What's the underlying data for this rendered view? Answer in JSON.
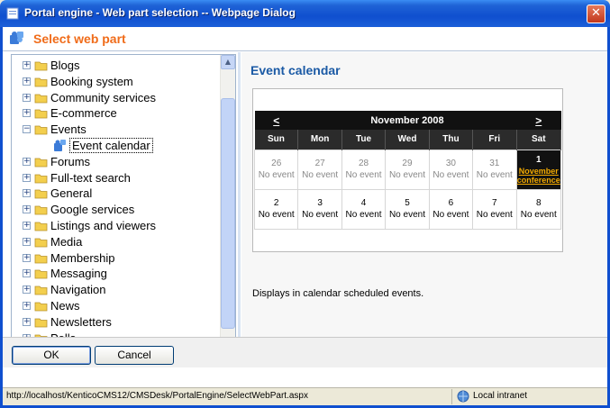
{
  "window": {
    "title": "Portal engine - Web part selection -- Webpage Dialog",
    "close_glyph": "✕"
  },
  "header": {
    "title": "Select web part"
  },
  "tree": {
    "items": [
      {
        "label": "Blogs",
        "exp": "+"
      },
      {
        "label": "Booking system",
        "exp": "+"
      },
      {
        "label": "Community services",
        "exp": "+"
      },
      {
        "label": "E-commerce",
        "exp": "+"
      },
      {
        "label": "Events",
        "exp": "−"
      },
      {
        "label": "Event calendar",
        "child": true
      },
      {
        "label": "Forums",
        "exp": "+"
      },
      {
        "label": "Full-text search",
        "exp": "+"
      },
      {
        "label": "General",
        "exp": "+"
      },
      {
        "label": "Google services",
        "exp": "+"
      },
      {
        "label": "Listings and viewers",
        "exp": "+"
      },
      {
        "label": "Media",
        "exp": "+"
      },
      {
        "label": "Membership",
        "exp": "+"
      },
      {
        "label": "Messaging",
        "exp": "+"
      },
      {
        "label": "Navigation",
        "exp": "+"
      },
      {
        "label": "News",
        "exp": "+"
      },
      {
        "label": "Newsletters",
        "exp": "+"
      },
      {
        "label": "Polls",
        "exp": "+"
      }
    ],
    "scroll_up": "▲",
    "scroll_down": "▼"
  },
  "preview": {
    "title": "Event calendar",
    "description": "Displays in calendar scheduled events.",
    "calendar": {
      "prev": "<",
      "next": ">",
      "month": "November 2008",
      "days": [
        "Sun",
        "Mon",
        "Tue",
        "Wed",
        "Thu",
        "Fri",
        "Sat"
      ],
      "week1": [
        {
          "n": "26",
          "e": "No event"
        },
        {
          "n": "27",
          "e": "No event"
        },
        {
          "n": "28",
          "e": "No event"
        },
        {
          "n": "29",
          "e": "No event"
        },
        {
          "n": "30",
          "e": "No event"
        },
        {
          "n": "31",
          "e": "No event"
        },
        {
          "n": "1",
          "e": "November conference"
        }
      ],
      "week2": [
        {
          "n": "2",
          "e": "No event"
        },
        {
          "n": "3",
          "e": "No event"
        },
        {
          "n": "4",
          "e": "No event"
        },
        {
          "n": "5",
          "e": "No event"
        },
        {
          "n": "6",
          "e": "No event"
        },
        {
          "n": "7",
          "e": "No event"
        },
        {
          "n": "8",
          "e": "No event"
        }
      ]
    }
  },
  "buttons": {
    "ok": "OK",
    "cancel": "Cancel"
  },
  "status": {
    "url": "http://localhost/KenticoCMS12/CMSDesk/PortalEngine/SelectWebPart.aspx",
    "zone": "Local intranet"
  },
  "colors": {
    "accent": "#f06c1a",
    "title_blue": "#1b5aa5",
    "titlebar": "#0f4fcf"
  }
}
